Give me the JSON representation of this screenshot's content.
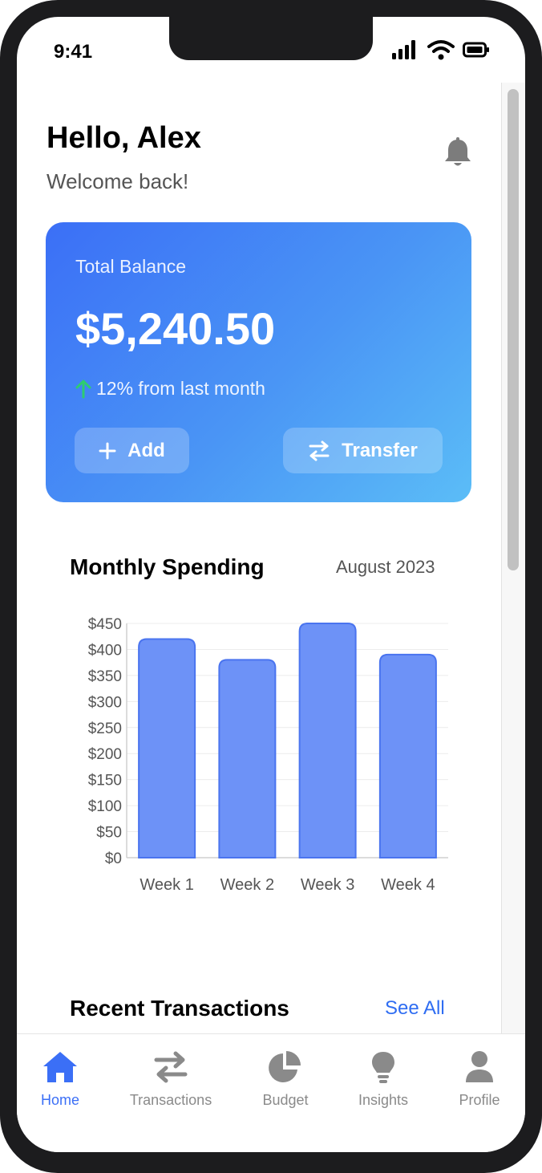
{
  "status_bar": {
    "time": "9:41"
  },
  "header": {
    "greeting": "Hello, Alex",
    "subtitle": "Welcome back!"
  },
  "balance": {
    "label": "Total Balance",
    "amount": "$5,240.50",
    "change": "12% from last month",
    "add_label": "Add",
    "transfer_label": "Transfer"
  },
  "spending": {
    "title": "Monthly Spending",
    "month": "August 2023"
  },
  "chart_data": {
    "type": "bar",
    "categories": [
      "Week 1",
      "Week 2",
      "Week 3",
      "Week 4"
    ],
    "values": [
      420,
      380,
      450,
      390
    ],
    "ylim": [
      0,
      450
    ],
    "yticks": [
      "$0",
      "$50",
      "$100",
      "$150",
      "$200",
      "$250",
      "$300",
      "$350",
      "$400",
      "$450"
    ],
    "grid": true,
    "bar_color": "#6d92f7"
  },
  "recent": {
    "title": "Recent Transactions",
    "see_all": "See All"
  },
  "tabs": [
    {
      "label": "Home",
      "icon": "home-icon",
      "active": true
    },
    {
      "label": "Transactions",
      "icon": "transfer-icon",
      "active": false
    },
    {
      "label": "Budget",
      "icon": "pie-chart-icon",
      "active": false
    },
    {
      "label": "Insights",
      "icon": "lightbulb-icon",
      "active": false
    },
    {
      "label": "Profile",
      "icon": "user-icon",
      "active": false
    }
  ],
  "colors": {
    "accent": "#3b6ff6",
    "positive": "#2ecc71",
    "icon_gray": "#8a8a8a"
  }
}
